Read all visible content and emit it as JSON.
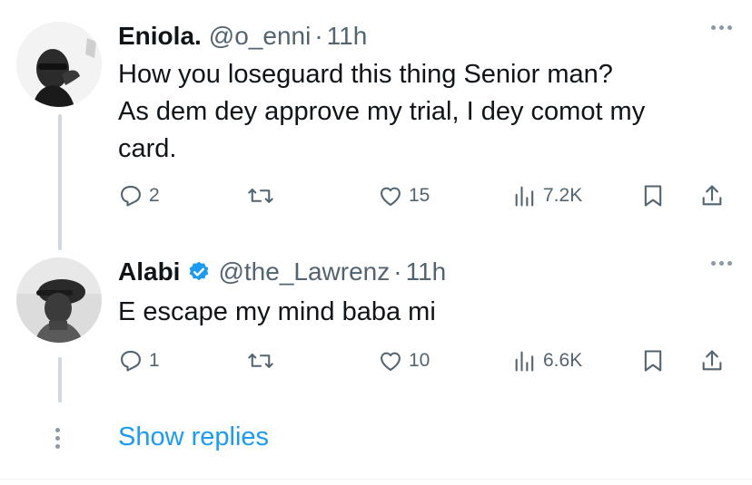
{
  "tweets": [
    {
      "name": "Eniola.",
      "handle": "@o_enni",
      "separator": "·",
      "time": "11h",
      "verified": false,
      "text_lines": [
        "How you loseguard this thing Senior man?",
        "As dem dey approve my trial, I dey comot my",
        "card."
      ],
      "replies": "2",
      "retweets": "",
      "likes": "15",
      "views": "7.2K"
    },
    {
      "name": "Alabi",
      "handle": "@the_Lawrenz",
      "separator": "·",
      "time": "11h",
      "verified": true,
      "text_lines": [
        "E escape my mind baba mi"
      ],
      "replies": "1",
      "retweets": "",
      "likes": "10",
      "views": "6.6K"
    }
  ],
  "show_replies_label": "Show replies",
  "colors": {
    "text": "#0f1419",
    "secondary": "#536471",
    "accent": "#1d9bf0",
    "thread_line": "#cfd9de"
  },
  "icons": [
    "more-icon",
    "reply-icon",
    "retweet-icon",
    "like-icon",
    "views-icon",
    "bookmark-icon",
    "share-icon",
    "verified-badge-icon"
  ]
}
